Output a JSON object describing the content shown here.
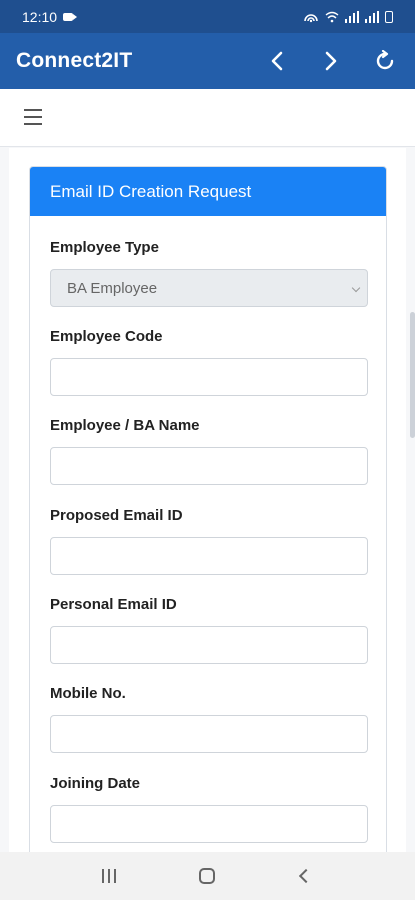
{
  "status_bar": {
    "time": "12:10"
  },
  "app_bar": {
    "title": "Connect2IT"
  },
  "form": {
    "header": "Email ID Creation Request",
    "fields": [
      {
        "label": "Employee Type",
        "value": "BA Employee",
        "type": "select"
      },
      {
        "label": "Employee Code",
        "value": "",
        "type": "text"
      },
      {
        "label": "Employee / BA Name",
        "value": "",
        "type": "text"
      },
      {
        "label": "Proposed Email ID",
        "value": "",
        "type": "text"
      },
      {
        "label": "Personal Email ID",
        "value": "",
        "type": "text"
      },
      {
        "label": "Mobile No.",
        "value": "",
        "type": "text"
      },
      {
        "label": "Joining Date",
        "value": "",
        "type": "text"
      }
    ]
  },
  "colors": {
    "status_bar": "#1f4f8f",
    "app_bar": "#235eaa",
    "card_header": "#1a82f5"
  }
}
